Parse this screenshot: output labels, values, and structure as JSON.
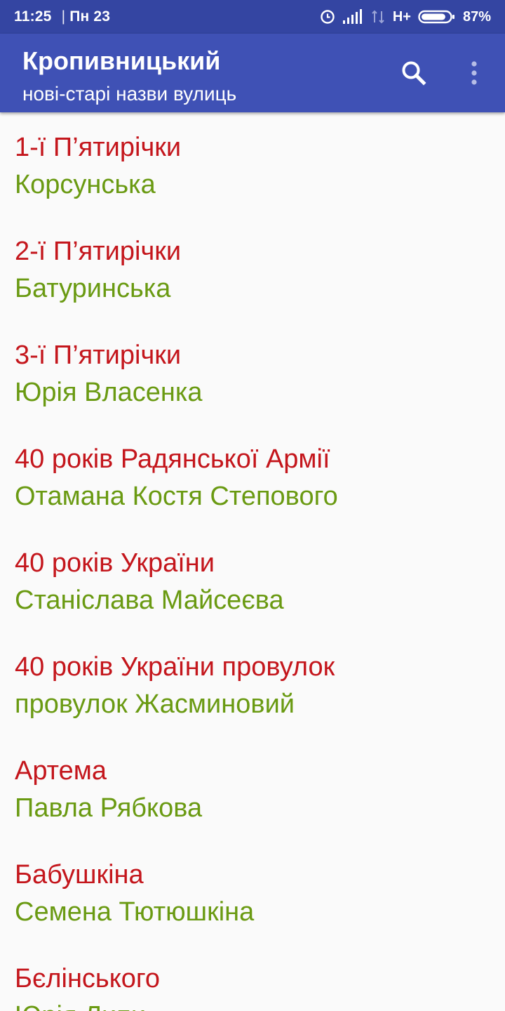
{
  "status_bar": {
    "time": "11:25",
    "separator": "|",
    "date": "Пн 23",
    "network": "H+",
    "battery_percent": "87%",
    "battery_level": 0.87,
    "icons": [
      "alarm-icon",
      "signal-icon",
      "signal-off-icon",
      "battery-icon"
    ]
  },
  "app_bar": {
    "title": "Кропивницький",
    "subtitle": "нові-старі назви вулиць",
    "actions": [
      "search-icon",
      "more-vert-icon"
    ]
  },
  "colors": {
    "primary": "#3f51b5",
    "primary_dark": "#3445a2",
    "old_name": "#c4161c",
    "new_name": "#6a9a12",
    "background": "#fafafa"
  },
  "streets": [
    {
      "old": "1-ї П’ятирічки",
      "new": "Корсунська"
    },
    {
      "old": "2-ї П’ятирічки",
      "new": "Батуринська"
    },
    {
      "old": "3-ї П’ятирічки",
      "new": "Юрія Власенка"
    },
    {
      "old": "40 років Радянської Армії",
      "new": "Отамана Костя Степового"
    },
    {
      "old": "40 років України",
      "new": "Станіслава Майсеєва"
    },
    {
      "old": "40 років України провулок",
      "new": "провулок Жасминовий"
    },
    {
      "old": "Артема",
      "new": "Павла Рябкова"
    },
    {
      "old": "Бабушкіна",
      "new": "Семена Тютюшкіна"
    },
    {
      "old": "Бєлінського",
      "new": "Юрія Липи"
    }
  ]
}
